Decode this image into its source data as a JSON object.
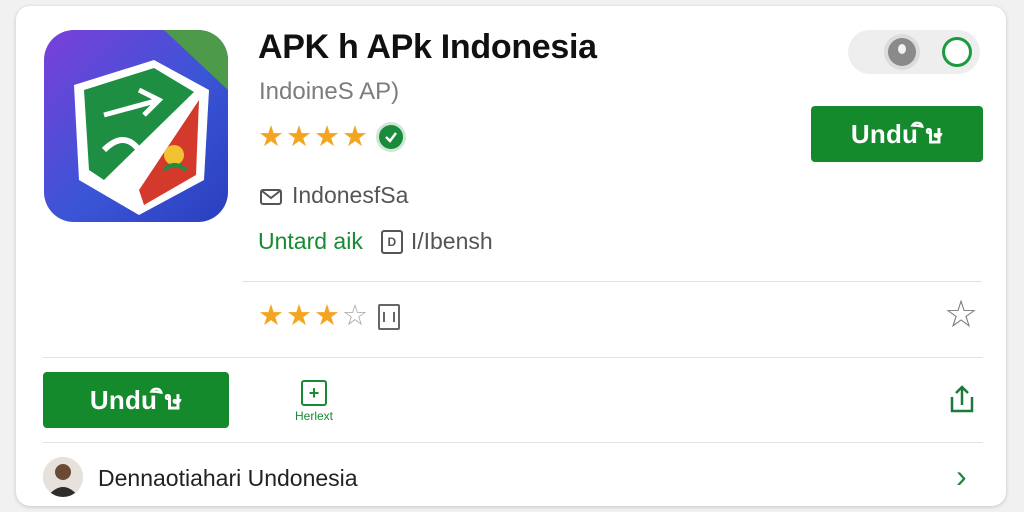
{
  "app": {
    "title": "APK h APk Indonesia",
    "subtitle": "IndoineS AP)",
    "rating_primary": 4,
    "developer": "IndonesfSa",
    "category": "Untard aik",
    "meta_label": "I/Ibensh",
    "doc_icon": "document-icon"
  },
  "actions": {
    "download_label_top": "Undu ╨╜",
    "download_label_bottom": "Undu ╨╜",
    "new_label": "Herlext",
    "new_icon_glyph": "+"
  },
  "rating_secondary": {
    "filled": 3,
    "total": 4
  },
  "footer": {
    "label": "Dennaotiahari Undonesia"
  },
  "colors": {
    "accent_green": "#148a2c",
    "star_gold": "#f3a521",
    "text_muted": "#7c7c7c"
  },
  "icons": [
    "mail-icon",
    "verified-icon",
    "document-icon",
    "grid-icon",
    "star-icon",
    "share-icon",
    "chevron-right-icon",
    "toggle-switch"
  ]
}
